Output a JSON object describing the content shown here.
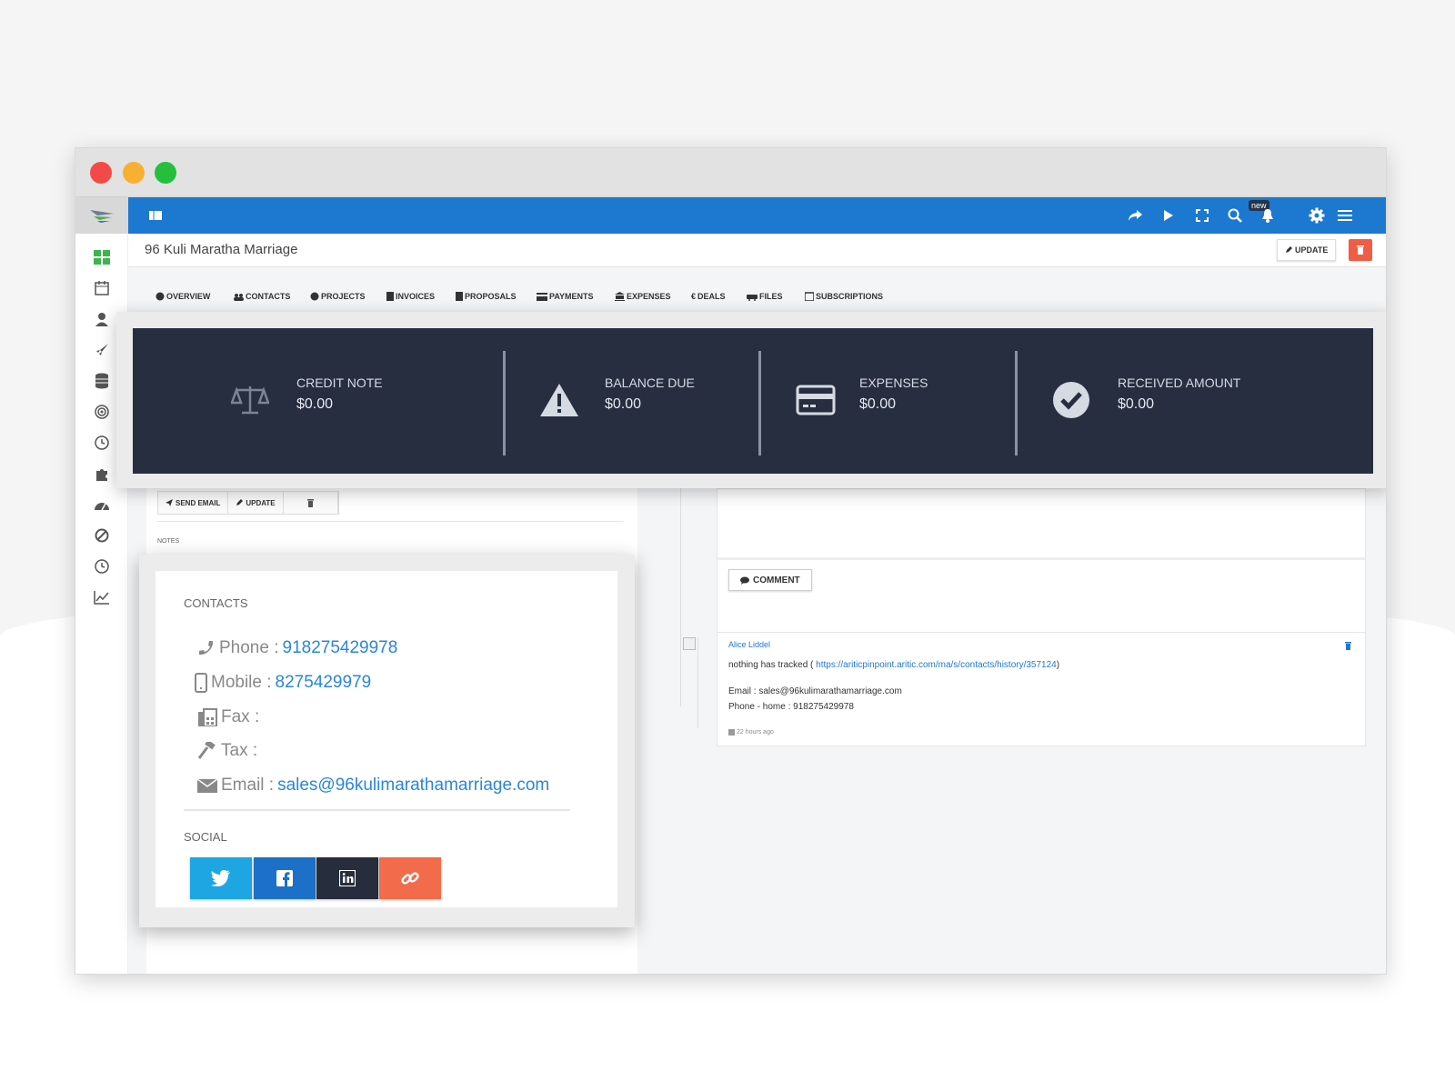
{
  "page": {
    "title": "96 Kuli Maratha Marriage"
  },
  "header": {
    "update_label": "UPDATE"
  },
  "topbar": {
    "new_badge": "new"
  },
  "tabs": [
    {
      "label": "Overview",
      "icon": "dashboard-icon"
    },
    {
      "label": "Contacts",
      "icon": "users-icon"
    },
    {
      "label": "Projects",
      "icon": "clock-icon"
    },
    {
      "label": "Invoices",
      "icon": "file-icon"
    },
    {
      "label": "Proposals",
      "icon": "file-icon"
    },
    {
      "label": "Payments",
      "icon": "card-icon"
    },
    {
      "label": "Expenses",
      "icon": "bank-icon"
    },
    {
      "label": "Deals",
      "icon": "euro-icon"
    },
    {
      "label": "Files",
      "icon": "car-icon"
    },
    {
      "label": "Subscriptions",
      "icon": "calendar-icon"
    }
  ],
  "stats": [
    {
      "label": "CREDIT NOTE",
      "value": "$0.00",
      "icon": "scale-icon"
    },
    {
      "label": "BALANCE DUE",
      "value": "$0.00",
      "icon": "warning-icon"
    },
    {
      "label": "EXPENSES",
      "value": "$0.00",
      "icon": "credit-card-icon"
    },
    {
      "label": "RECEIVED AMOUNT",
      "value": "$0.00",
      "icon": "check-circle-icon"
    }
  ],
  "actions": {
    "send_email": "SEND EMAIL",
    "update": "UPDATE"
  },
  "notes_label": "NOTES",
  "comment": {
    "button_label": "COMMENT"
  },
  "activity": {
    "user": "Alice Liddel",
    "text": "nothing has tracked (",
    "link": "https://ariticpinpoint.aritic.com/ma/s/contacts/history/357124",
    "text_end": ")",
    "email_line": "Email : sales@96kulimarathamarriage.com",
    "phone_line": "Phone - home : 918275429978",
    "time": "22 hours ago"
  },
  "contacts": {
    "title": "CONTACTS",
    "phone_label": "Phone :",
    "phone": "918275429978",
    "mobile_label": "Mobile :",
    "mobile": "8275429979",
    "fax_label": "Fax :",
    "tax_label": "Tax :",
    "email_label": "Email :",
    "email": "sales@96kulimarathamarriage.com"
  },
  "social": {
    "title": "SOCIAL",
    "buttons": [
      {
        "name": "twitter",
        "color": "#1da6e2"
      },
      {
        "name": "facebook",
        "color": "#1d70c8"
      },
      {
        "name": "linkedin",
        "color": "#262e3e"
      },
      {
        "name": "link",
        "color": "#f26b4a"
      }
    ]
  },
  "colors": {
    "brand_blue": "#1d78d0",
    "stats_bg": "#262e40",
    "danger": "#f05c44"
  }
}
